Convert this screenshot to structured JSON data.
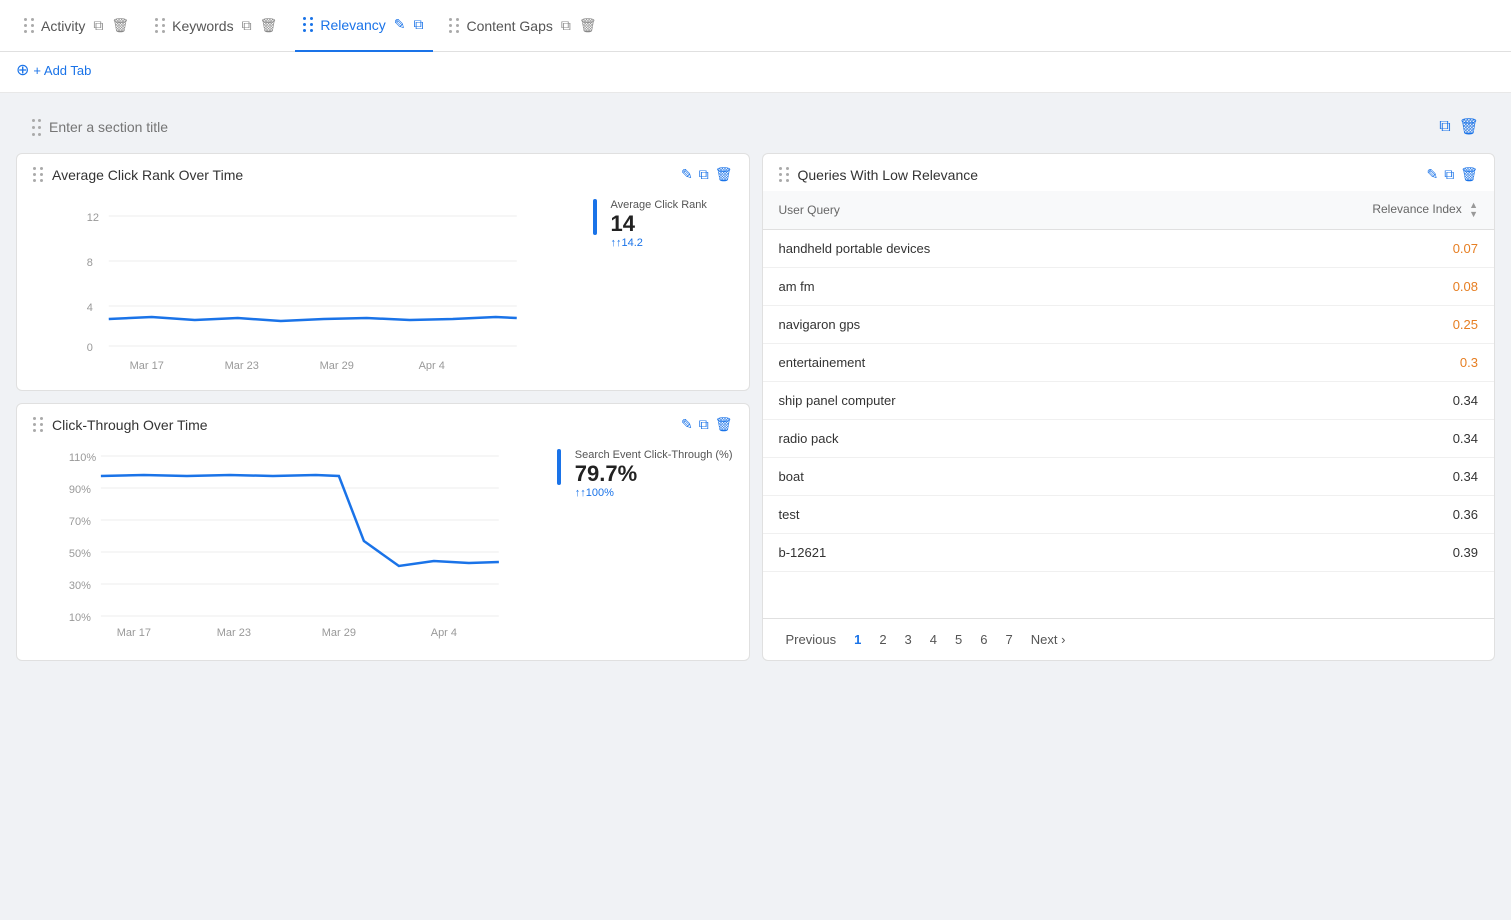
{
  "tabs": [
    {
      "id": "activity",
      "label": "Activity",
      "active": false
    },
    {
      "id": "keywords",
      "label": "Keywords",
      "active": false
    },
    {
      "id": "relevancy",
      "label": "Relevancy",
      "active": true
    },
    {
      "id": "content-gaps",
      "label": "Content Gaps",
      "active": false
    }
  ],
  "add_tab_label": "+ Add Tab",
  "section": {
    "title_placeholder": "Enter a section title"
  },
  "avg_click_rank_card": {
    "title": "Average Click Rank Over Time",
    "legend_label": "Average Click Rank",
    "legend_value": "14",
    "legend_sub": "↑14.2",
    "x_labels": [
      "Mar 17",
      "Mar 23",
      "Mar 29",
      "Apr 4"
    ],
    "y_labels": [
      "12",
      "8",
      "4",
      "0"
    ]
  },
  "click_through_card": {
    "title": "Click-Through Over Time",
    "legend_label": "Search Event Click-Through (%)",
    "legend_value": "79.7%",
    "legend_sub": "↑100%",
    "x_labels": [
      "Mar 17",
      "Mar 23",
      "Mar 29",
      "Apr 4"
    ],
    "y_labels": [
      "110%",
      "90%",
      "70%",
      "50%",
      "30%",
      "10%"
    ]
  },
  "queries_card": {
    "title": "Queries With Low Relevance",
    "table": {
      "col_query": "User Query",
      "col_relevance": "Relevance Index",
      "rows": [
        {
          "query": "handheld portable devices",
          "value": "0.07",
          "highlight": true
        },
        {
          "query": "am fm",
          "value": "0.08",
          "highlight": true
        },
        {
          "query": "navigaron gps",
          "value": "0.25",
          "highlight": true
        },
        {
          "query": "entertainement",
          "value": "0.3",
          "highlight": true
        },
        {
          "query": "ship panel computer",
          "value": "0.34",
          "highlight": false
        },
        {
          "query": "radio pack",
          "value": "0.34",
          "highlight": false
        },
        {
          "query": "boat",
          "value": "0.34",
          "highlight": false
        },
        {
          "query": "test",
          "value": "0.36",
          "highlight": false
        },
        {
          "query": "b-12621",
          "value": "0.39",
          "highlight": false
        }
      ]
    },
    "pagination": {
      "prev": "Previous",
      "next": "Next",
      "pages": [
        "1",
        "2",
        "3",
        "4",
        "5",
        "6",
        "7"
      ]
    }
  },
  "icons": {
    "drag": "⠿",
    "edit": "✎",
    "copy": "⧉",
    "delete": "🗑",
    "plus": "+"
  }
}
